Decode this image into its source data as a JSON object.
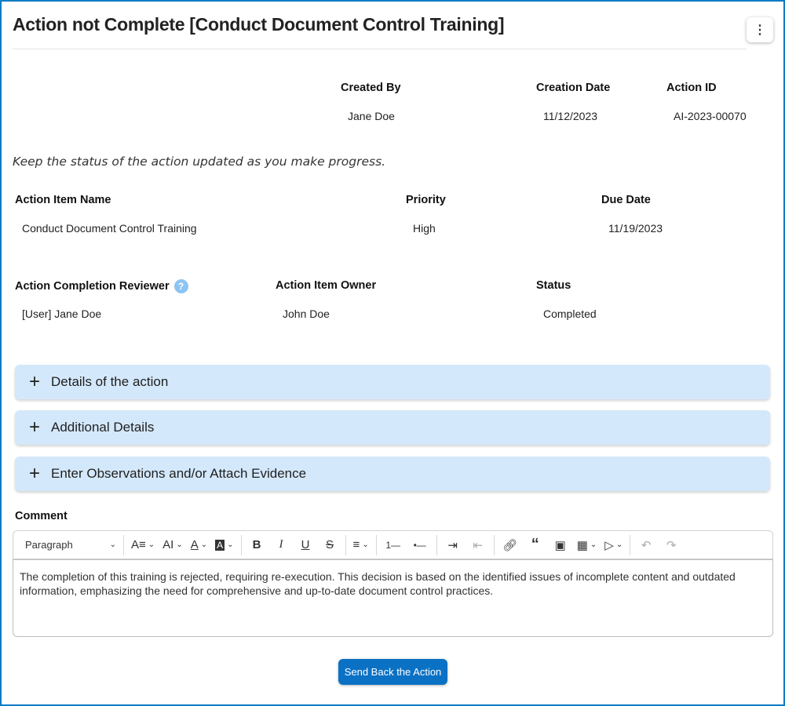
{
  "header": {
    "title": "Action not Complete [Conduct Document Control Training]",
    "menu_icon": "⋮"
  },
  "meta": {
    "created_by_label": "Created By",
    "created_by": "Jane Doe",
    "creation_date_label": "Creation Date",
    "creation_date": "11/12/2023",
    "action_id_label": "Action ID",
    "action_id": "AI-2023-00070"
  },
  "hint": "Keep the status of the action updated as you make progress.",
  "fields": {
    "name_label": "Action Item Name",
    "name": "Conduct Document Control Training",
    "priority_label": "Priority",
    "priority": "High",
    "due_label": "Due Date",
    "due": "11/19/2023",
    "reviewer_label": "Action Completion Reviewer",
    "reviewer": "[User] Jane Doe",
    "help": "?",
    "owner_label": "Action Item Owner",
    "owner": "John Doe",
    "status_label": "Status",
    "status": "Completed"
  },
  "accordions": [
    {
      "label": "Details of the action"
    },
    {
      "label": "Additional Details"
    },
    {
      "label": "Enter Observations and/or Attach Evidence"
    }
  ],
  "plus": "+",
  "comment": {
    "label": "Comment",
    "block_format": "Paragraph",
    "text": "The completion of this training is rejected, requiring re-execution. This decision is based on the identified issues of incomplete content and outdated information, emphasizing the need for comprehensive and up-to-date document control practices."
  },
  "actions": {
    "send_back": "Send Back the Action"
  }
}
